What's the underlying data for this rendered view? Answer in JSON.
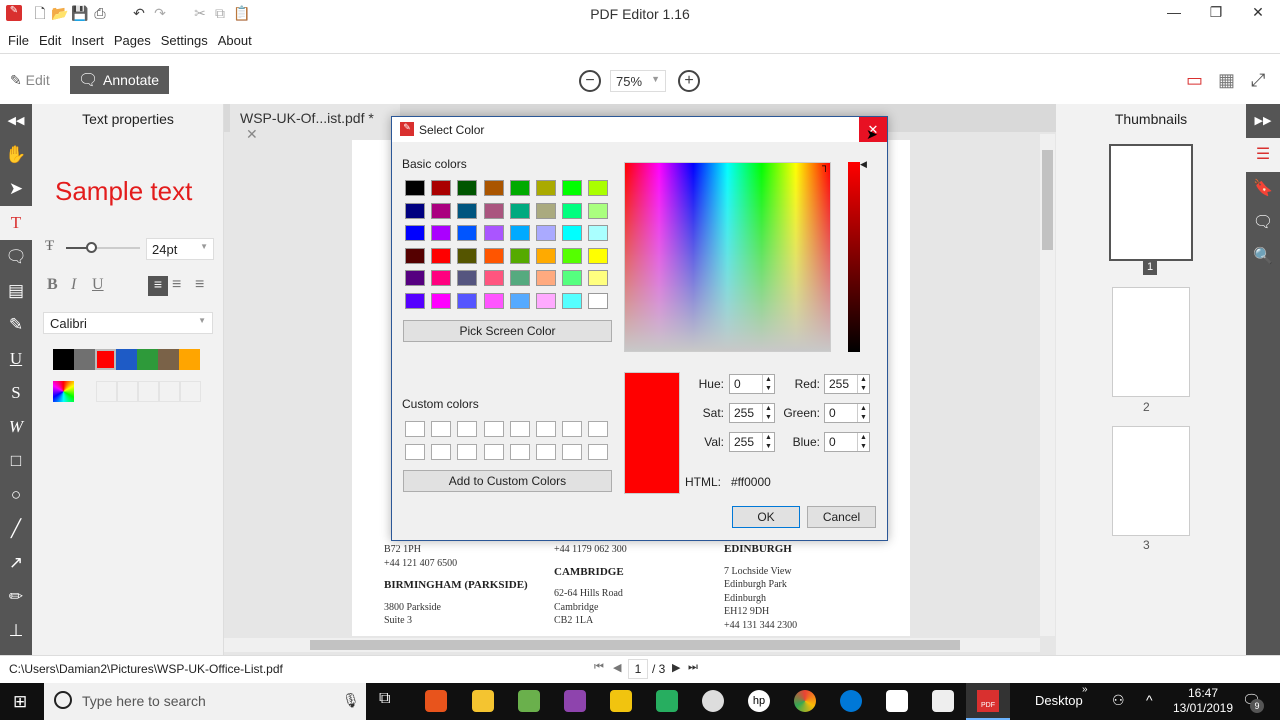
{
  "app": {
    "title": "PDF Editor 1.16"
  },
  "menu": [
    "File",
    "Edit",
    "Insert",
    "Pages",
    "Settings",
    "About"
  ],
  "toolbar": {
    "edit": "Edit",
    "annotate": "Annotate",
    "zoom": "75%"
  },
  "left_panel": {
    "title": "Text properties",
    "sample": "Sample text",
    "size": "24pt",
    "font": "Calibri",
    "colors": [
      "#000000",
      "#707070",
      "#ff0000",
      "#1e5bc6",
      "#2e9a3a",
      "#7a6248",
      "#ffa500"
    ],
    "selected_color": "#ff0000"
  },
  "tab": {
    "label": "WSP-UK-Of...ist.pdf *"
  },
  "right_panel": {
    "title": "Thumbnails",
    "pages": [
      "1",
      "2",
      "3"
    ]
  },
  "document": {
    "columns": [
      {
        "lines": [
          "B72 1PH",
          "+44 121 407 6500"
        ],
        "heading": "BIRMINGHAM (PARKSIDE)",
        "lines2": [
          "3800 Parkside",
          "Suite 3"
        ]
      },
      {
        "lines": [
          "+44 1179 062 300"
        ],
        "heading": "CAMBRIDGE",
        "lines2": [
          "62-64 Hills Road",
          "Cambridge",
          "CB2 1LA"
        ]
      },
      {
        "heading": "EDINBURGH",
        "lines2": [
          "7 Lochside View",
          "Edinburgh Park",
          "Edinburgh",
          "EH12 9DH",
          "+44 131 344 2300"
        ]
      }
    ]
  },
  "dialog": {
    "title": "Select Color",
    "basic_label": "Basic colors",
    "basic_colors": [
      "#000000",
      "#aa0000",
      "#005500",
      "#aa5500",
      "#00aa00",
      "#aaaa00",
      "#00ff00",
      "#aaff00",
      "#000080",
      "#aa007f",
      "#00557f",
      "#aa557f",
      "#00aa7f",
      "#aaaa7f",
      "#00ff7f",
      "#aaff7f",
      "#0000ff",
      "#aa00ff",
      "#0055ff",
      "#aa55ff",
      "#00aaff",
      "#aaaaff",
      "#00ffff",
      "#aaffff",
      "#550000",
      "#ff0000",
      "#555500",
      "#ff5500",
      "#55aa00",
      "#ffaa00",
      "#55ff00",
      "#ffff00",
      "#550080",
      "#ff007f",
      "#55557f",
      "#ff557f",
      "#55aa7f",
      "#ffaa7f",
      "#55ff7f",
      "#ffff7f",
      "#5500ff",
      "#ff00ff",
      "#5555ff",
      "#ff55ff",
      "#55aaff",
      "#ffaaff",
      "#55ffff",
      "#ffffff"
    ],
    "pick": "Pick Screen Color",
    "custom_label": "Custom colors",
    "add_custom": "Add to Custom Colors",
    "hue_label": "Hue:",
    "hue": "0",
    "sat_label": "Sat:",
    "sat": "255",
    "val_label": "Val:",
    "val": "255",
    "red_label": "Red:",
    "red": "255",
    "green_label": "Green:",
    "green": "0",
    "blue_label": "Blue:",
    "blue": "0",
    "html_label": "HTML:",
    "html": "#ff0000",
    "ok": "OK",
    "cancel": "Cancel",
    "current_color": "#ff0000"
  },
  "status": {
    "path": "C:\\Users\\Damian2\\Pictures\\WSP-UK-Office-List.pdf",
    "page": "1",
    "total": "/ 3"
  },
  "taskbar": {
    "search": "Type here to search",
    "desktop": "Desktop",
    "time": "16:47",
    "date": "13/01/2019",
    "notifications": "9"
  }
}
